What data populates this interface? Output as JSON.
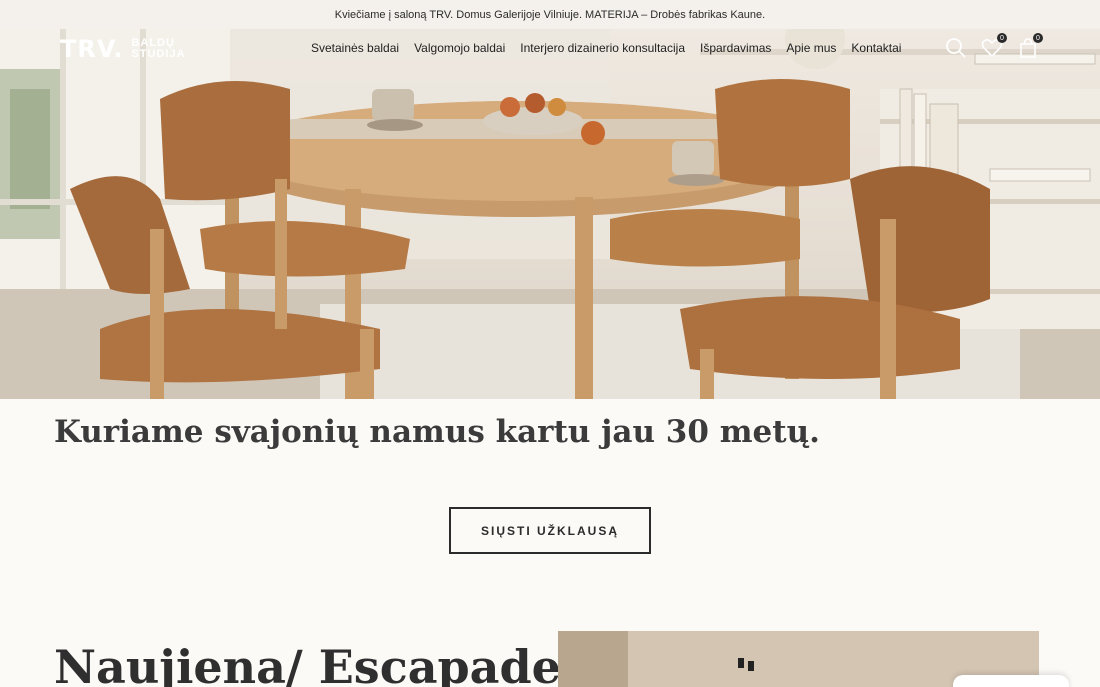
{
  "announcement": "Kviečiame į saloną TRV. Domus Galerijoje Vilniuje. MATERIJA – Drobės fabrikas Kaune.",
  "logo": {
    "main": "TRV.",
    "sub_line1": "BALDŲ",
    "sub_line2": "STUDIJA"
  },
  "nav": [
    {
      "label": "Svetainės baldai"
    },
    {
      "label": "Valgomojo baldai"
    },
    {
      "label": "Interjero dizainerio konsultacija"
    },
    {
      "label": "Išpardavimas"
    },
    {
      "label": "Apie mus"
    },
    {
      "label": "Kontaktai"
    }
  ],
  "header_icons": {
    "search": "search-icon",
    "wishlist": "heart-icon",
    "wishlist_count": "0",
    "cart": "shopping-bag-icon",
    "cart_count": "0"
  },
  "hero": {
    "image": "dining-room-photo"
  },
  "headline": "Kuriame svajonių namus kartu jau 30 metų.",
  "cta_label": "SIŲSTI UŽKLAUSĄ",
  "news": {
    "title": "Naujiena/ Escapade"
  }
}
